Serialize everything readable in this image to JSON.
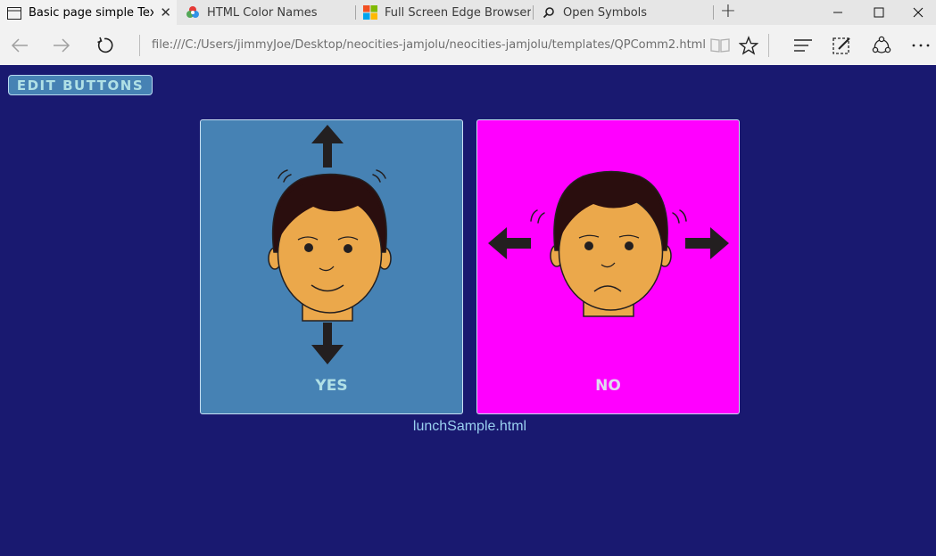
{
  "tabs": [
    {
      "title": "Basic page simple Text t",
      "icon": "page-icon",
      "active": true
    },
    {
      "title": "HTML Color Names",
      "icon": "color-wheel-icon",
      "active": false
    },
    {
      "title": "Full Screen Edge Browser -",
      "icon": "windows-logo-icon",
      "active": false
    },
    {
      "title": "Open Symbols",
      "icon": "search-icon",
      "active": false
    }
  ],
  "address": {
    "url": "file:///C:/Users/jimmyJoe/Desktop/neocities-jamjolu/neocities-jamjolu/templates/QPComm2.html"
  },
  "page": {
    "edit_button": "EDIT BUTTONS",
    "cards": [
      {
        "label": "YES",
        "background": "#4682b4",
        "gesture": "nod-up-down"
      },
      {
        "label": "NO",
        "background": "#ff00ff",
        "gesture": "shake-left-right"
      }
    ],
    "filename": "lunchSample.html"
  },
  "colors": {
    "page_background": "#191970",
    "yes_card": "#4682b4",
    "no_card": "#ff00ff",
    "label_text": "#b0e0e6",
    "skin": "#eba84b",
    "hair": "#2a0e0e"
  }
}
